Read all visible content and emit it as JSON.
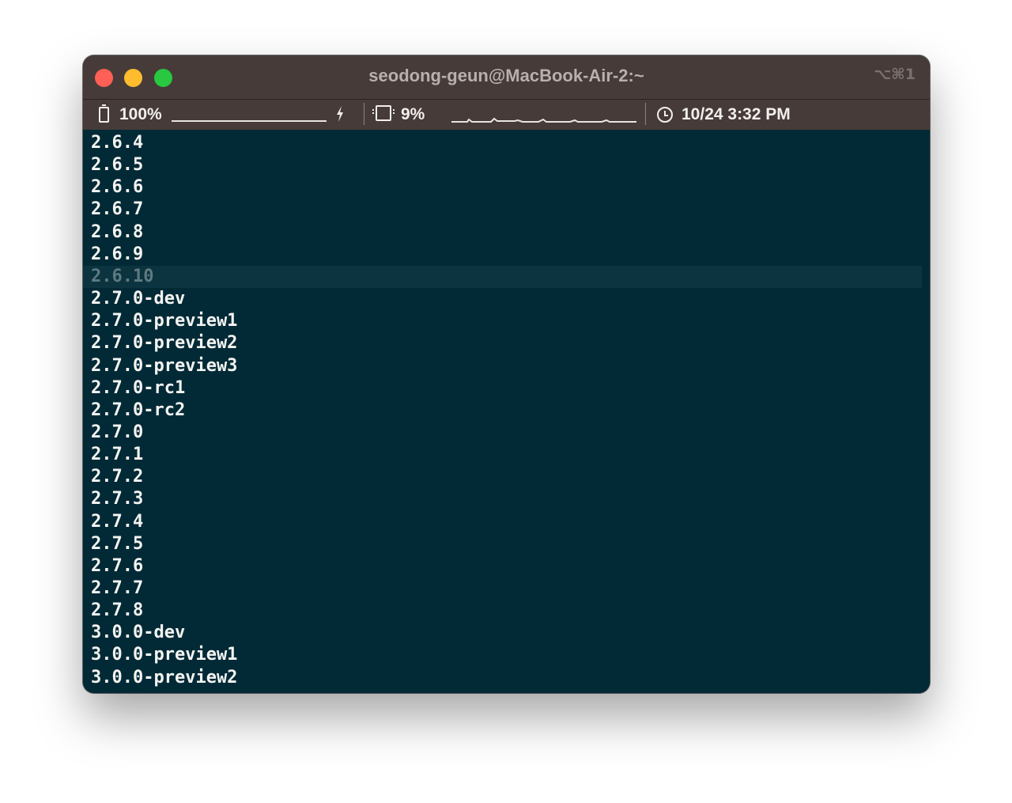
{
  "window": {
    "title": "seodong-geun@MacBook-Air-2:~",
    "shortcut": "⌥⌘1",
    "traffic_lights": {
      "close_color": "#fe5f57",
      "minimize_color": "#febc2e",
      "maximize_color": "#28c840"
    }
  },
  "statusbar": {
    "battery": "100%",
    "charging_icon": "lightning-icon",
    "cpu": "9%",
    "datetime": "10/24 3:32 PM"
  },
  "terminal": {
    "background": "#022a36",
    "lines": [
      "2.6.4",
      "2.6.5",
      "2.6.6",
      "2.6.7",
      "2.6.8",
      "2.6.9",
      "2.6.10",
      "2.7.0-dev",
      "2.7.0-preview1",
      "2.7.0-preview2",
      "2.7.0-preview3",
      "2.7.0-rc1",
      "2.7.0-rc2",
      "2.7.0",
      "2.7.1",
      "2.7.2",
      "2.7.3",
      "2.7.4",
      "2.7.5",
      "2.7.6",
      "2.7.7",
      "2.7.8",
      "3.0.0-dev",
      "3.0.0-preview1",
      "3.0.0-preview2"
    ],
    "highlighted_line": "2.6.10"
  }
}
